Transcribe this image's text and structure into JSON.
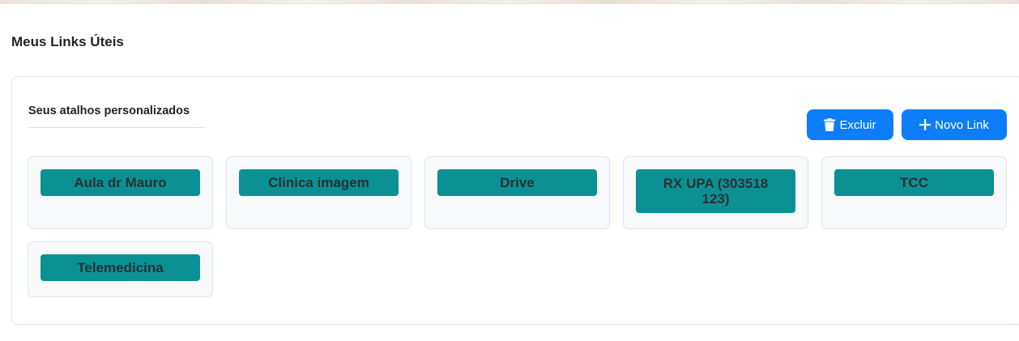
{
  "page": {
    "title": "Meus Links Úteis"
  },
  "panel": {
    "subtitle": "Seus atalhos personalizados",
    "delete_label": "Excluir",
    "new_label": "Novo Link"
  },
  "links": [
    {
      "label": "Aula dr Mauro"
    },
    {
      "label": "Clinica imagem"
    },
    {
      "label": "Drive"
    },
    {
      "label": "RX UPA (303518 123)"
    },
    {
      "label": "TCC"
    },
    {
      "label": "Telemedicina"
    }
  ],
  "colors": {
    "primary_button": "#0d7dfa",
    "link_button": "#0b9193",
    "tile_background": "#f7f9fb"
  },
  "icons": {
    "delete": "trash-icon",
    "new": "plus-icon"
  }
}
